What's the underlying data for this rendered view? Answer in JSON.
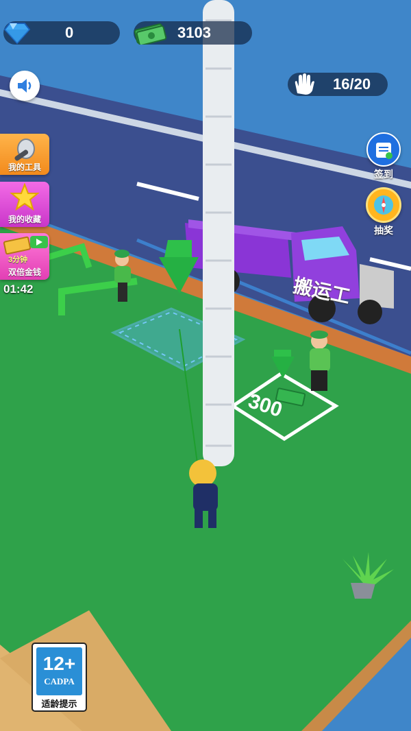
{
  "hud": {
    "gems": "0",
    "cash": "3103",
    "capacity": "16/20"
  },
  "side_menu": {
    "tools_label": "我的工具",
    "collection_label": "我的收藏",
    "double_badge": "3分钟",
    "double_label": "双倍金钱",
    "timer": "01:42"
  },
  "right_menu": {
    "checkin_label": "签到",
    "lottery_label": "抽奖"
  },
  "world": {
    "truck_label": "搬运工",
    "drop_zone_price": "300"
  },
  "age_rating": {
    "age": "12+",
    "org": "CADPA",
    "caption": "适龄提示"
  },
  "colors": {
    "grass": "#2fa24a",
    "road": "#3a4f8e",
    "truck": "#8a35d6",
    "hud_bg": "#14284699"
  },
  "icons": [
    "diamond-icon",
    "cash-icon",
    "speaker-icon",
    "hand-icon",
    "wrench-icon",
    "star-icon",
    "video-icon",
    "calendar-icon",
    "compass-icon"
  ]
}
